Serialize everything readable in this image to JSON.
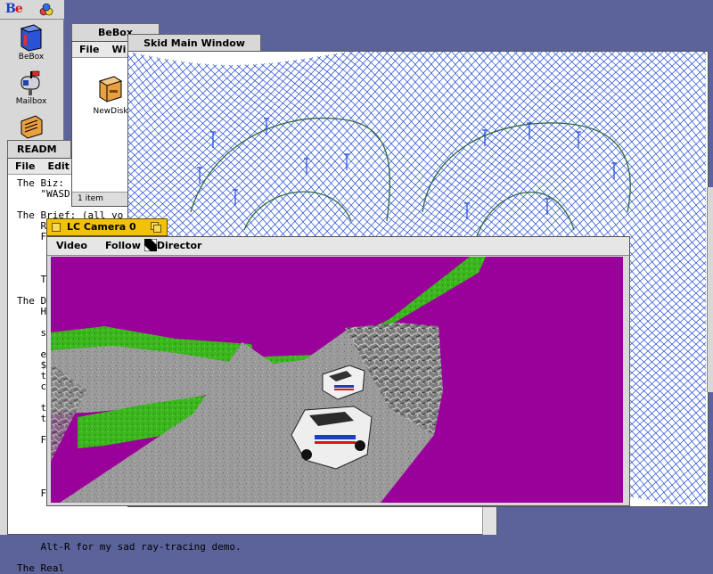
{
  "deskbar": {
    "be_menu": {
      "logo_b": "B",
      "logo_e": "e"
    },
    "items": [
      {
        "label": "BeBox",
        "icon": "bebox-icon"
      },
      {
        "label": "Mailbox",
        "icon": "mailbox-icon"
      },
      {
        "label": "",
        "icon": "drawer-icon"
      }
    ]
  },
  "readme": {
    "title": "READM",
    "menu": [
      "File",
      "Edit"
    ],
    "lines": [
      "The Biz:",
      "    \"WASD",
      "",
      "The Brief: (all yo",
      "    R",
      "    F",
      "",
      "",
      "",
      "    T",
      "",
      "The D",
      "    H",
      "",
      "    s",
      "",
      "    e",
      "    $",
      "    t",
      "    c",
      "",
      "    t",
      "    t",
      "",
      "    F",
      "",
      "",
      "",
      "",
      "    F",
      "",
      "",
      "",
      "",
      "    Alt-R for my sad ray-tracing demo.",
      "",
      "The Real"
    ]
  },
  "bebox": {
    "title": "BeBox",
    "menu": [
      "File",
      "Wi"
    ],
    "icon_label": "NewDisk",
    "status": "1 item"
  },
  "skid": {
    "title": "Skid Main Window",
    "mesh_color": "#1f49d8",
    "track_color": "#2f6a3a"
  },
  "camera": {
    "title": "LC Camera 0",
    "menu": [
      "Video",
      "Follow",
      "Director"
    ],
    "sky_color": "#9a009a",
    "grass_color": "#38b81e"
  }
}
